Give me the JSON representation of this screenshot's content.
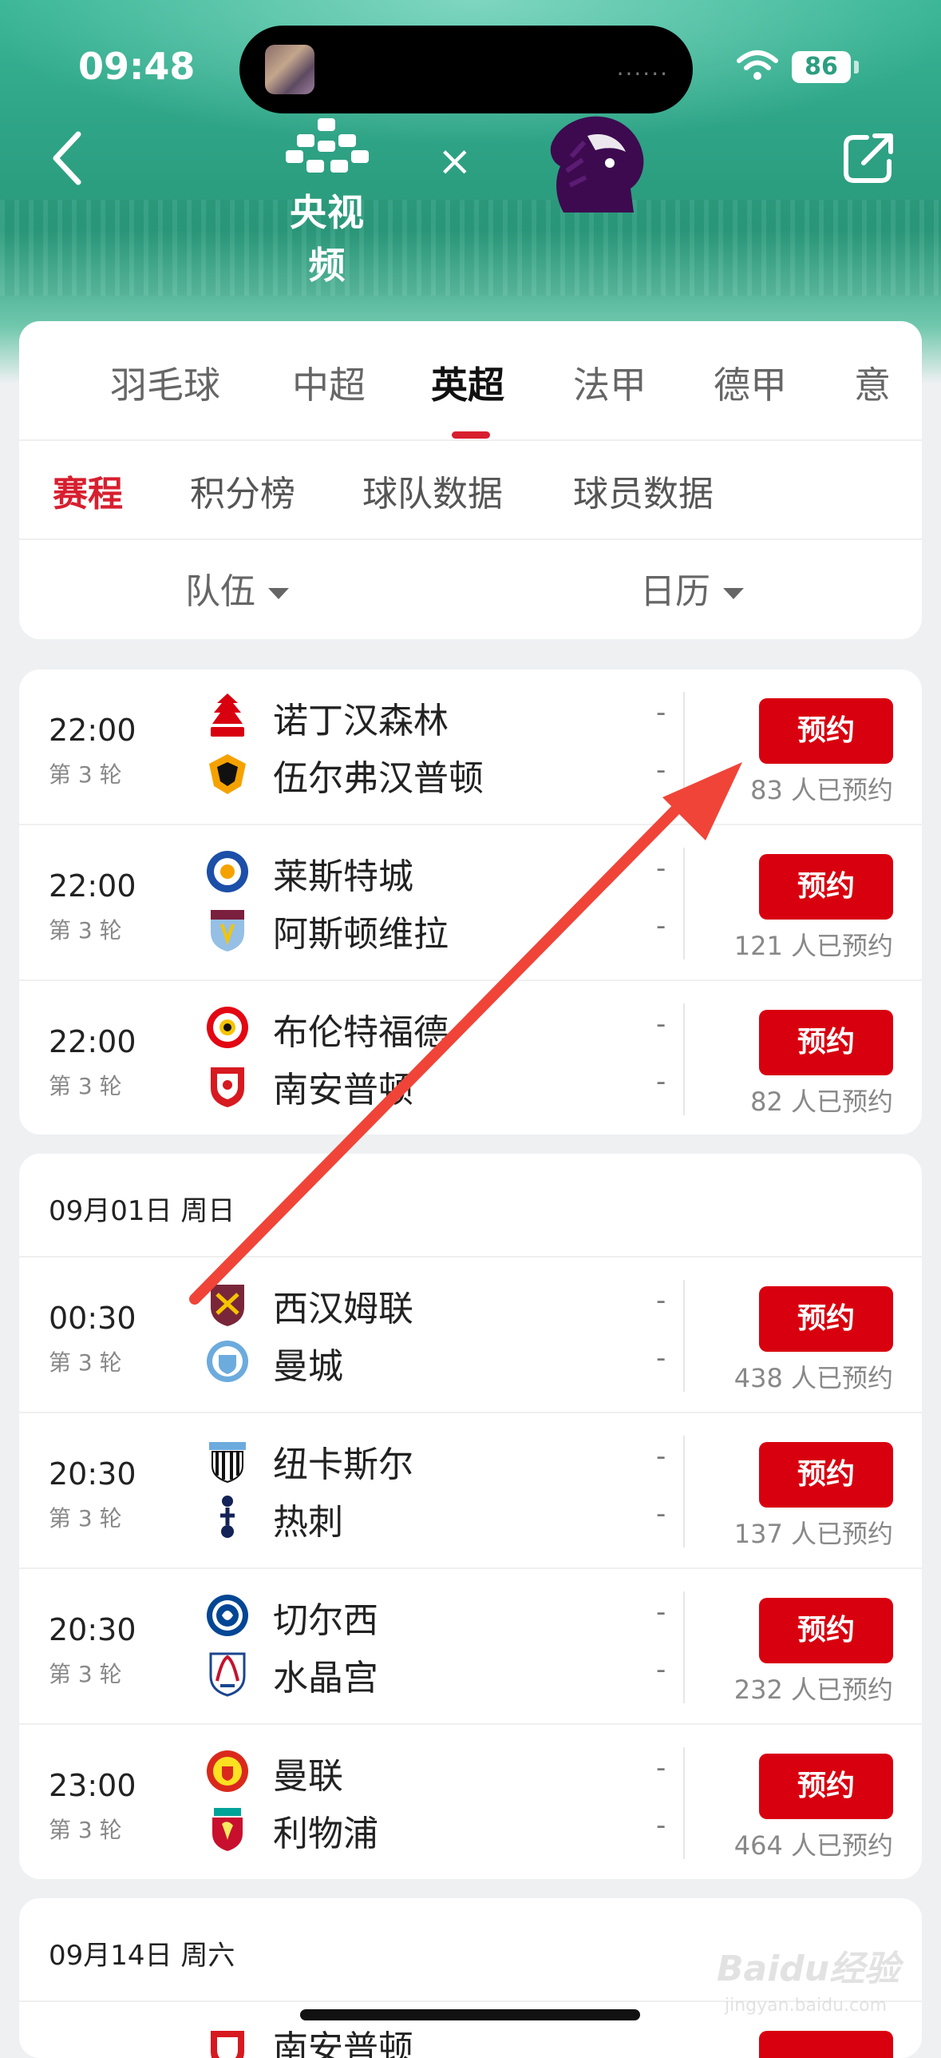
{
  "status_bar": {
    "time": "09:48",
    "island_dots": "......",
    "battery": "86"
  },
  "header": {
    "brand": "央视频",
    "separator": "×"
  },
  "league_tabs": [
    "羽毛球",
    "中超",
    "英超",
    "法甲",
    "德甲",
    "意"
  ],
  "active_league": "英超",
  "sub_tabs": [
    "赛程",
    "积分榜",
    "球队数据",
    "球员数据"
  ],
  "active_sub_tab": "赛程",
  "filters": {
    "team": "队伍",
    "calendar": "日历"
  },
  "sections": [
    {
      "date": "",
      "matches": [
        {
          "time": "22:00",
          "round": "第 3 轮",
          "home": "诺丁汉森林",
          "away": "伍尔弗汉普顿",
          "home_score": "-",
          "away_score": "-",
          "button": "预约",
          "count": "83 人已预约"
        },
        {
          "time": "22:00",
          "round": "第 3 轮",
          "home": "莱斯特城",
          "away": "阿斯顿维拉",
          "home_score": "-",
          "away_score": "-",
          "button": "预约",
          "count": "121 人已预约"
        },
        {
          "time": "22:00",
          "round": "第 3 轮",
          "home": "布伦特福德",
          "away": "南安普顿",
          "home_score": "-",
          "away_score": "-",
          "button": "预约",
          "count": "82 人已预约"
        }
      ]
    },
    {
      "date": "09月01日 周日",
      "matches": [
        {
          "time": "00:30",
          "round": "第 3 轮",
          "home": "西汉姆联",
          "away": "曼城",
          "home_score": "-",
          "away_score": "-",
          "button": "预约",
          "count": "438 人已预约"
        },
        {
          "time": "20:30",
          "round": "第 3 轮",
          "home": "纽卡斯尔",
          "away": "热刺",
          "home_score": "-",
          "away_score": "-",
          "button": "预约",
          "count": "137 人已预约"
        },
        {
          "time": "20:30",
          "round": "第 3 轮",
          "home": "切尔西",
          "away": "水晶宫",
          "home_score": "-",
          "away_score": "-",
          "button": "预约",
          "count": "232 人已预约"
        },
        {
          "time": "23:00",
          "round": "第 3 轮",
          "home": "曼联",
          "away": "利物浦",
          "home_score": "-",
          "away_score": "-",
          "button": "预约",
          "count": "464 人已预约"
        }
      ]
    },
    {
      "date": "09月14日 周六",
      "matches": [
        {
          "time": "",
          "round": "",
          "home": "南安普顿",
          "away": "",
          "home_score": "",
          "away_score": "",
          "button": "",
          "count": ""
        }
      ]
    }
  ],
  "watermark": {
    "main": "Baidu经验",
    "sub": "jingyan.baidu.com"
  },
  "colors": {
    "accent": "#d8000f",
    "header_green": "#2ea385",
    "pl_purple": "#3d0a4f"
  },
  "icons": [
    "back-icon",
    "share-icon",
    "wifi-icon",
    "caret-down-icon",
    "team-crest-icon"
  ]
}
